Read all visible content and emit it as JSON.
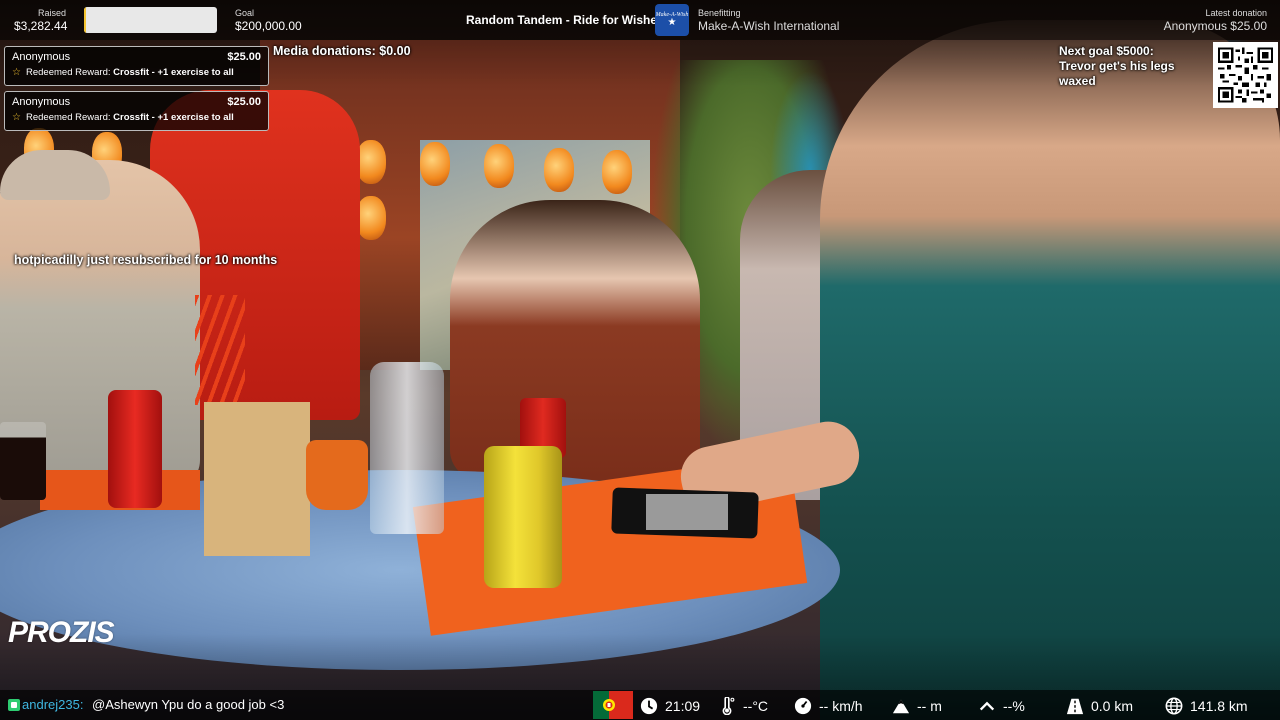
{
  "stream": {
    "raised_label": "Raised",
    "raised_value": "$3,282.44",
    "progress_fraction": 0.0164,
    "goal_label": "Goal",
    "goal_value": "$200,000.00",
    "event_title": "Random Tandem - Ride for Wishes",
    "charity_logo_text": "Make-A-Wish",
    "benefiting_label": "Benefitting",
    "benefiting_value": "Make-A-Wish International",
    "latest_label": "Latest donation",
    "latest_value": "Anonymous $25.00"
  },
  "donations": [
    {
      "name": "Anonymous",
      "amount": "$25.00",
      "message_prefix": "Redeemed Reward: ",
      "message_reward": "Crossfit - +1 exercise to all"
    },
    {
      "name": "Anonymous",
      "amount": "$25.00",
      "message_prefix": "Redeemed Reward: ",
      "message_reward": "Crossfit - +1 exercise to all"
    }
  ],
  "overlay": {
    "media_donations": "Media donations: $0.00",
    "resub_alert": "hotpicadilly just resubscribed for 10 months",
    "next_goal_line1": "Next goal $5000:",
    "next_goal_line2": "Trevor get's his legs",
    "next_goal_line3": "waxed",
    "sponsor_logo": "PROZIS"
  },
  "chat": {
    "user": "andrej235:",
    "message": "@Ashewyn Ypu do a good job <3"
  },
  "telemetry": {
    "flag": "portugal-flag",
    "time": "21:09",
    "temperature": "--°C",
    "speed": "-- km/h",
    "altitude": "-- m",
    "incline": "--%",
    "distance": "0.0 km",
    "total_distance": "141.8 km"
  },
  "colors": {
    "progress_fill": "#f4c431",
    "chat_user": "#3fb6e0",
    "charity_blue": "#1c4fa8"
  }
}
